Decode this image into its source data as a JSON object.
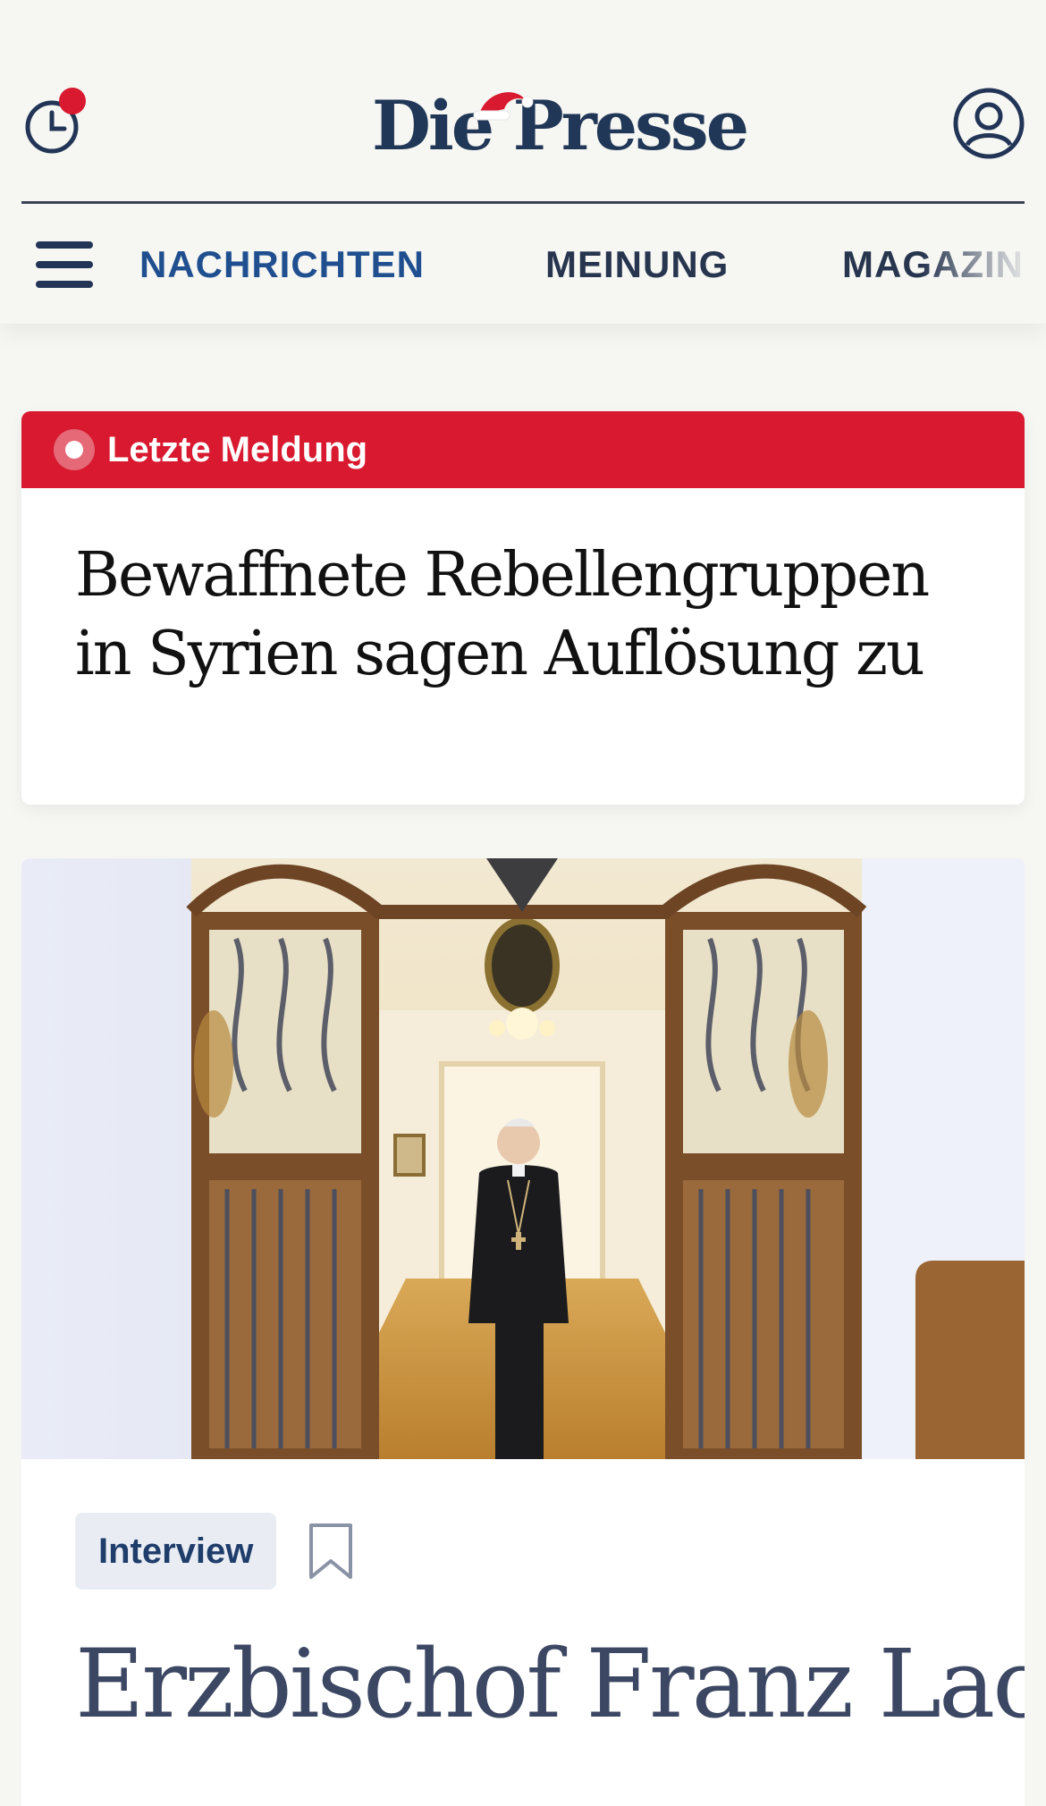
{
  "header": {
    "logo_text": "Die Presse",
    "history_icon": "clock-history-icon",
    "account_icon": "user-account-icon",
    "notification_color": "#d8192f"
  },
  "nav": {
    "menu_icon": "hamburger-menu-icon",
    "items": [
      {
        "label": "NACHRICHTEN",
        "active": true
      },
      {
        "label": "MEINUNG",
        "active": false
      },
      {
        "label": "MAGAZIN",
        "active": false
      }
    ],
    "active_color": "#1f4f8f"
  },
  "breaking": {
    "label": "Letzte Meldung",
    "headline": "Bewaffnete Rebellengruppen in Syrien sagen Auflösung zu",
    "accent_color": "#d8192f"
  },
  "article": {
    "image_alt_icon": "hero-photo",
    "tag": "Interview",
    "bookmark_icon": "bookmark-icon",
    "headline": "Erzbischof Franz Lackner: „Die Zeit"
  }
}
